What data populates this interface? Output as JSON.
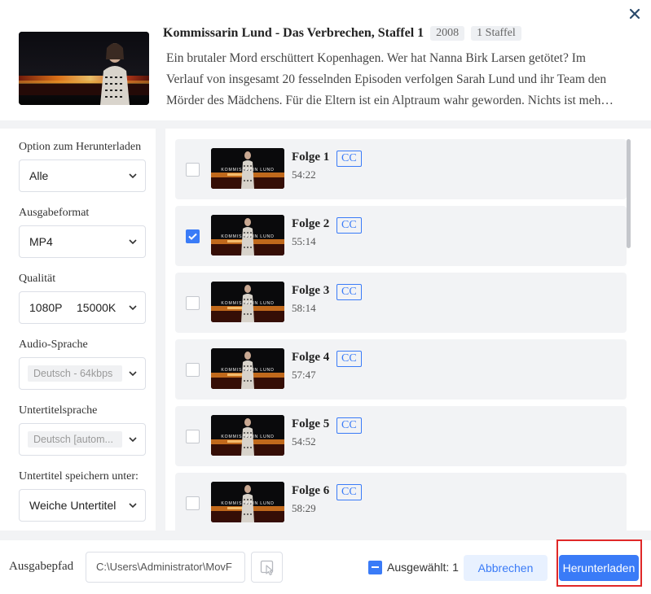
{
  "header": {
    "title": "Kommissarin Lund - Das Verbrechen, Staffel 1",
    "year": "2008",
    "seasons": "1 Staffel",
    "description_lines": [
      "Ein brutaler Mord erschüttert Kopenhagen. Wer hat Nanna Birk Larsen getötet? Im",
      "Verlauf von insgesamt 20 fesselnden Episoden verfolgen Sarah Lund und ihr Team den",
      "Mörder des Mädchens. Für die Eltern ist ein Alptraum wahr geworden. Nichts ist meh…"
    ],
    "close_icon": "close-icon"
  },
  "options": {
    "download_option": {
      "label": "Option zum Herunterladen",
      "value": "Alle"
    },
    "output_format": {
      "label": "Ausgabeformat",
      "value": "MP4"
    },
    "quality": {
      "label": "Qualität",
      "resolution": "1080P",
      "bitrate": "15000K"
    },
    "audio_language": {
      "label": "Audio-Sprache",
      "value": "Deutsch - 64kbps"
    },
    "subtitle_language": {
      "label": "Untertitelsprache",
      "value": "Deutsch [autom..."
    },
    "subtitle_save": {
      "label": "Untertitel speichern unter:",
      "value": "Weiche Untertitel"
    }
  },
  "thumbnail_text": "KOMMISSARIN LUND",
  "episodes": [
    {
      "title": "Folge 1",
      "duration": "54:22",
      "cc": "CC",
      "checked": false
    },
    {
      "title": "Folge 2",
      "duration": "55:14",
      "cc": "CC",
      "checked": true
    },
    {
      "title": "Folge 3",
      "duration": "58:14",
      "cc": "CC",
      "checked": false
    },
    {
      "title": "Folge 4",
      "duration": "57:47",
      "cc": "CC",
      "checked": false
    },
    {
      "title": "Folge 5",
      "duration": "54:52",
      "cc": "CC",
      "checked": false
    },
    {
      "title": "Folge 6",
      "duration": "58:29",
      "cc": "CC",
      "checked": false
    }
  ],
  "footer": {
    "path_label": "Ausgabepfad",
    "path_value": "C:\\Users\\Administrator\\MovF",
    "selected_text": "Ausgewählt: 1",
    "cancel_label": "Abbrechen",
    "download_label": "Herunterladen"
  },
  "colors": {
    "accent": "#3a7bf7",
    "highlight": "#e02828",
    "background": "#f2f3f5"
  }
}
